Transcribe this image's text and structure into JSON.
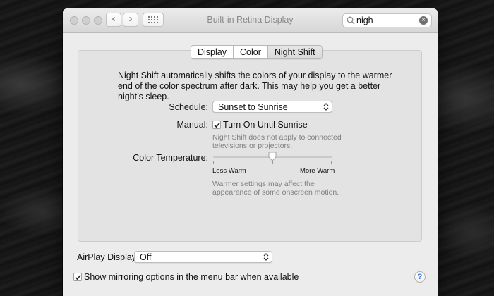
{
  "window": {
    "title": "Built-in Retina Display"
  },
  "toolbar": {
    "back_icon": "‹",
    "forward_icon": "›",
    "show_all_icon": "grid-icon"
  },
  "search": {
    "value": "nigh",
    "clear_icon": "×"
  },
  "tabs": [
    {
      "label": "Display",
      "active": false
    },
    {
      "label": "Color",
      "active": false
    },
    {
      "label": "Night Shift",
      "active": true
    }
  ],
  "night_shift": {
    "description": "Night Shift automatically shifts the colors of your display to the warmer end of the color spectrum after dark. This may help you get a better night’s sleep.",
    "schedule_label": "Schedule:",
    "schedule_value": "Sunset to Sunrise",
    "manual_label": "Manual:",
    "manual_checkbox_label": "Turn On Until Sunrise",
    "manual_checked": true,
    "manual_note": "Night Shift does not apply to connected televisions or projectors.",
    "temperature_label": "Color Temperature:",
    "temperature_min_label": "Less Warm",
    "temperature_max_label": "More Warm",
    "temperature_level": 0.5,
    "temperature_note": "Warmer settings may affect the appearance of some onscreen motion."
  },
  "airplay": {
    "label": "AirPlay Display:",
    "value": "Off"
  },
  "mirroring": {
    "label": "Show mirroring options in the menu bar when available",
    "checked": true
  },
  "help": {
    "icon": "?"
  }
}
